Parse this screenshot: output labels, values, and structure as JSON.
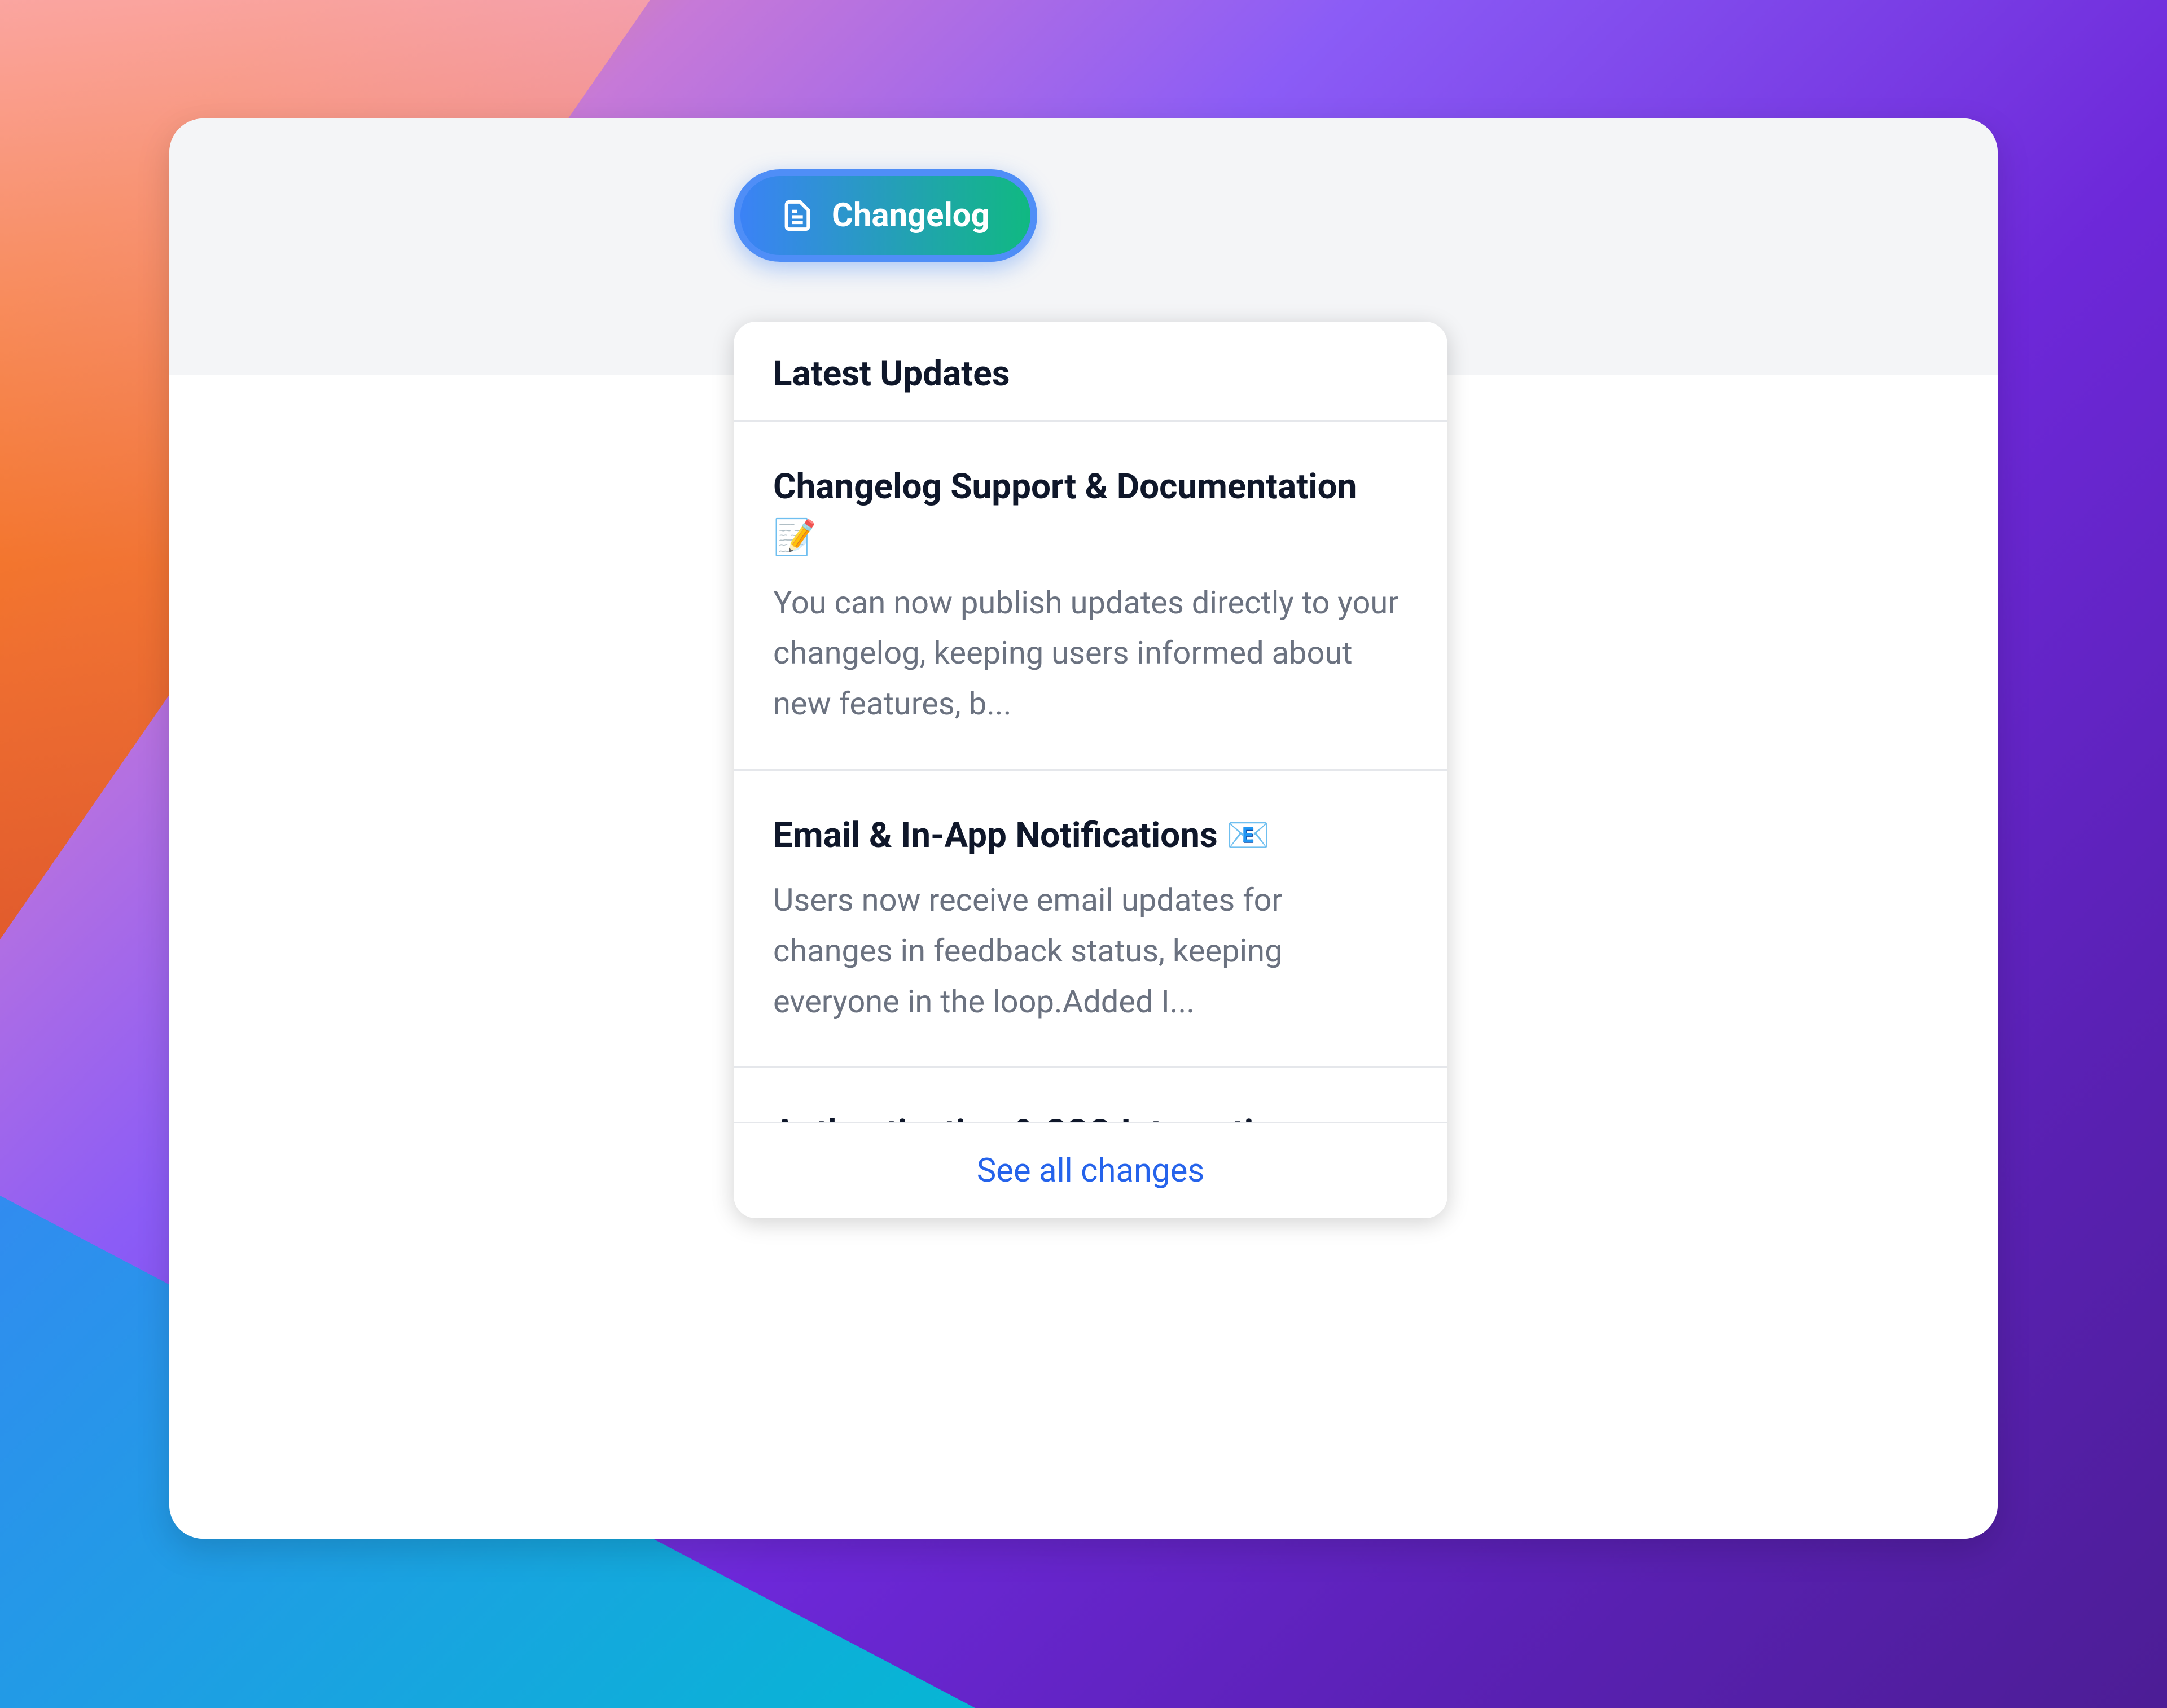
{
  "button": {
    "label": "Changelog"
  },
  "dropdown": {
    "title": "Latest Updates",
    "footer_link": "See all changes",
    "items": [
      {
        "title": "Changelog Support & Documentation 📝",
        "description": "You can now publish updates directly to your changelog, keeping users informed about new features, b..."
      },
      {
        "title": "Email & In-App Notifications 📧",
        "description": "Users now receive email updates for changes in feedback status, keeping everyone in the loop.Added I..."
      },
      {
        "title": "Authentication & SSO Integration",
        "description": ""
      }
    ]
  }
}
